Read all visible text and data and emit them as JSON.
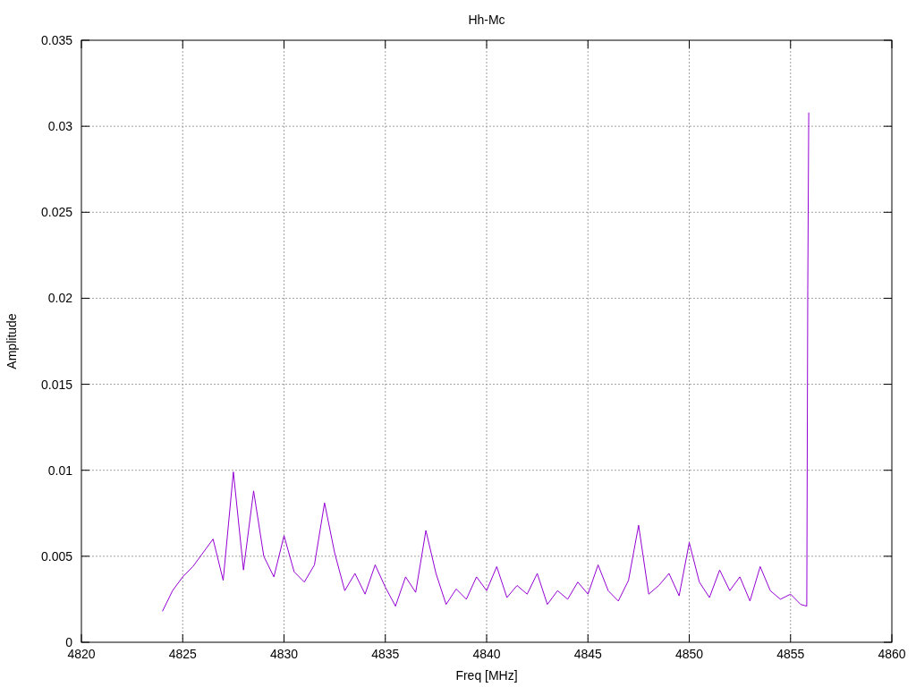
{
  "chart_data": {
    "type": "line",
    "title": "Hh-Mc",
    "xlabel": "Freq [MHz]",
    "ylabel": "Amplitude",
    "x": [
      4824,
      4824.5,
      4825,
      4825.5,
      4826,
      4826.5,
      4827,
      4827.5,
      4828,
      4828.5,
      4829,
      4829.5,
      4830,
      4830.5,
      4831,
      4831.5,
      4832,
      4832.5,
      4833,
      4833.5,
      4834,
      4834.5,
      4835,
      4835.5,
      4836,
      4836.5,
      4837,
      4837.5,
      4838,
      4838.5,
      4839,
      4839.5,
      4840,
      4840.5,
      4841,
      4841.5,
      4842,
      4842.5,
      4843,
      4843.5,
      4844,
      4844.5,
      4845,
      4845.5,
      4846,
      4846.5,
      4847,
      4847.5,
      4848,
      4848.5,
      4849,
      4849.5,
      4850,
      4850.5,
      4851,
      4851.5,
      4852,
      4852.5,
      4853,
      4853.5,
      4854,
      4854.5,
      4855,
      4855.5,
      4855.8,
      4855.85,
      4855.9
    ],
    "series": [
      {
        "color": "#9400d3",
        "values": [
          0.0018,
          0.003,
          0.0038,
          0.0044,
          0.0052,
          0.006,
          0.0036,
          0.0099,
          0.0042,
          0.0088,
          0.005,
          0.0038,
          0.0062,
          0.0041,
          0.0035,
          0.0045,
          0.0081,
          0.0052,
          0.003,
          0.004,
          0.0028,
          0.0045,
          0.0032,
          0.0021,
          0.0038,
          0.0029,
          0.0065,
          0.004,
          0.0022,
          0.0031,
          0.0025,
          0.0038,
          0.003,
          0.0044,
          0.0026,
          0.0033,
          0.0028,
          0.004,
          0.0022,
          0.003,
          0.0025,
          0.0035,
          0.0028,
          0.0045,
          0.003,
          0.0024,
          0.0036,
          0.0068,
          0.0028,
          0.0033,
          0.004,
          0.0027,
          0.0058,
          0.0035,
          0.0026,
          0.0042,
          0.003,
          0.0038,
          0.0024,
          0.0044,
          0.003,
          0.0025,
          0.0028,
          0.0022,
          0.0021,
          0.0205,
          0.0308
        ]
      }
    ],
    "grid": true,
    "xlim": [
      4820,
      4860
    ],
    "ylim": [
      0,
      0.035
    ],
    "xticks": [
      4820,
      4825,
      4830,
      4835,
      4840,
      4845,
      4850,
      4855,
      4860
    ],
    "yticks": [
      0,
      0.005,
      0.01,
      0.015,
      0.02,
      0.025,
      0.03,
      0.035
    ]
  }
}
